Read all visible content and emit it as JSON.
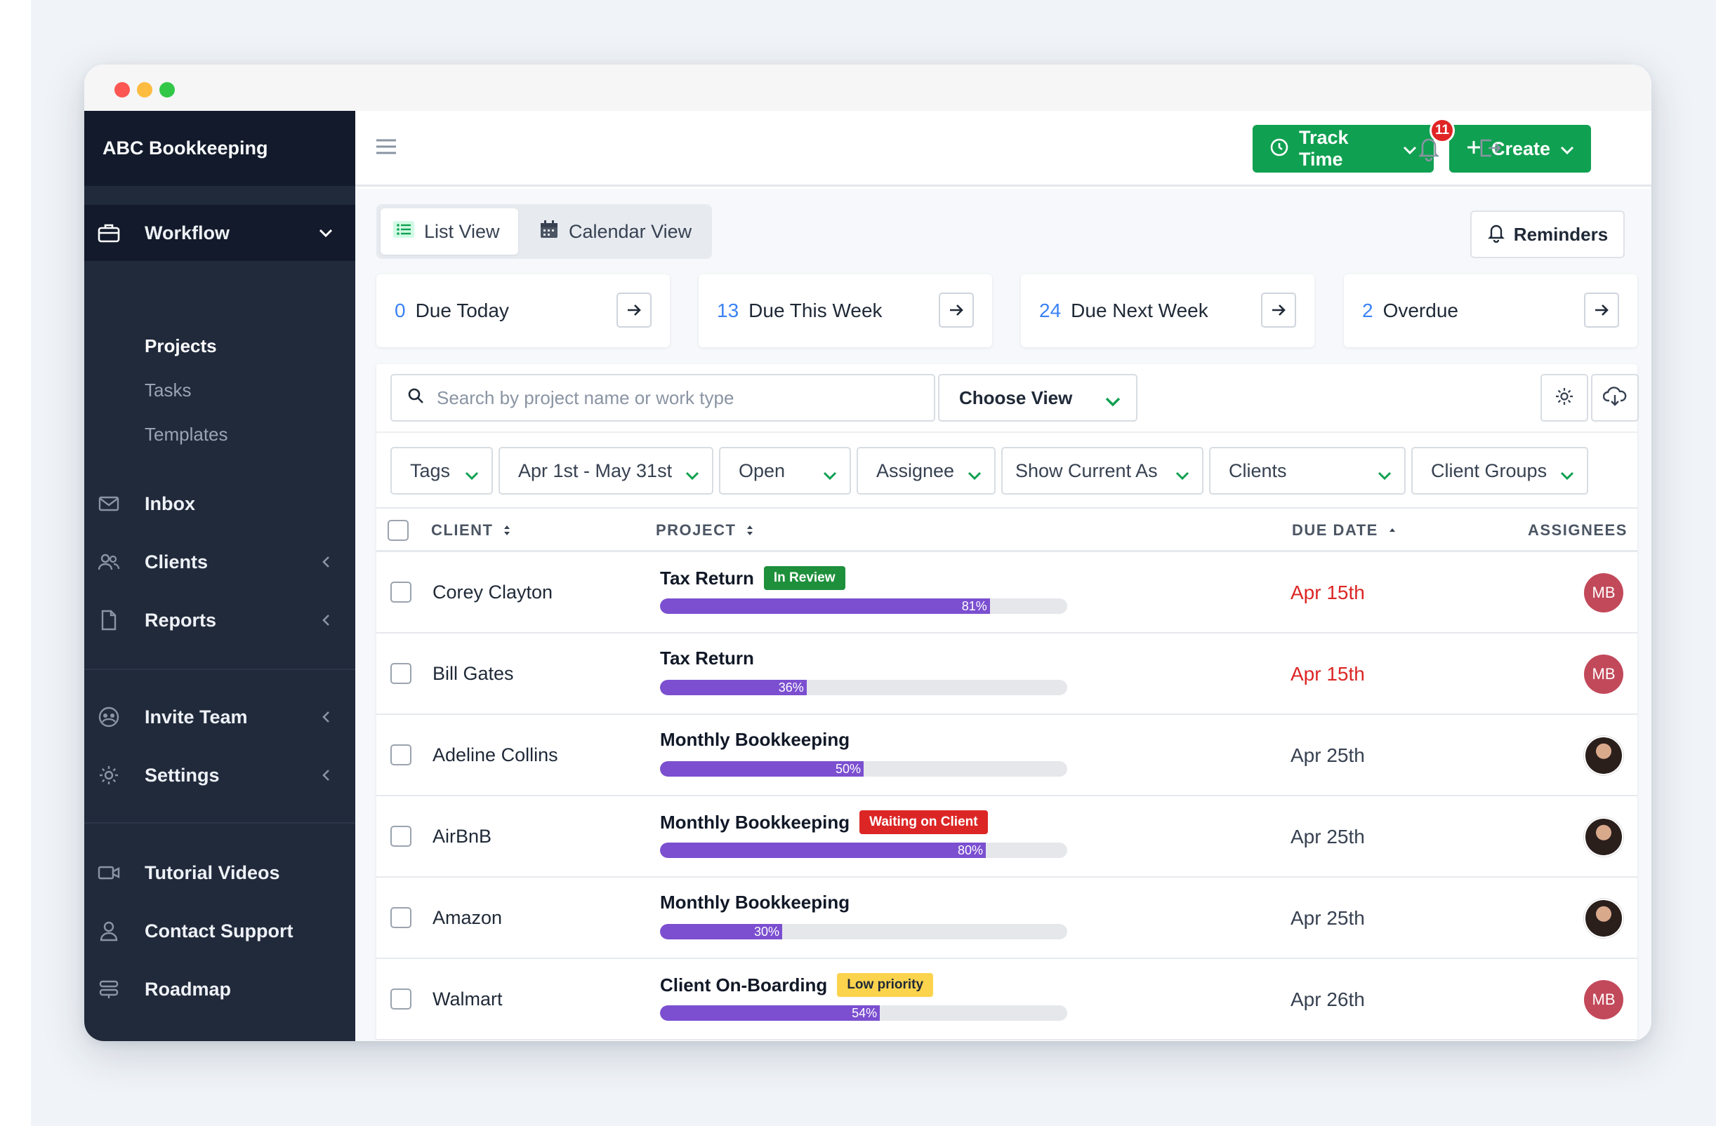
{
  "brand": "ABC Bookkeeping",
  "sidebar": {
    "workflow": "Workflow",
    "sub": [
      "Projects",
      "Tasks",
      "Templates"
    ],
    "items": [
      {
        "label": "Inbox",
        "icon": "envelope-icon"
      },
      {
        "label": "Clients",
        "icon": "users-icon"
      },
      {
        "label": "Reports",
        "icon": "document-icon"
      },
      {
        "label": "Invite Team",
        "icon": "team-icon"
      },
      {
        "label": "Settings",
        "icon": "gear-icon"
      },
      {
        "label": "Tutorial Videos",
        "icon": "video-icon"
      },
      {
        "label": "Contact Support",
        "icon": "person-icon"
      },
      {
        "label": "Roadmap",
        "icon": "roadmap-icon"
      }
    ]
  },
  "topbar": {
    "track_time": "Track Time",
    "create": "Create",
    "notification_count": "11"
  },
  "views": {
    "list": "List View",
    "calendar": "Calendar View",
    "reminders": "Reminders"
  },
  "stats": [
    {
      "num": "0",
      "label": "Due Today"
    },
    {
      "num": "13",
      "label": "Due This Week"
    },
    {
      "num": "24",
      "label": "Due Next Week"
    },
    {
      "num": "2",
      "label": "Overdue"
    }
  ],
  "search": {
    "placeholder": "Search by project name or work type"
  },
  "choose_view": "Choose View",
  "filters": [
    "Tags",
    "Apr 1st - May 31st",
    "Open",
    "Assignee",
    "Show Current As",
    "Clients",
    "Client Groups"
  ],
  "table": {
    "headers": {
      "client": "CLIENT",
      "project": "PROJECT",
      "due": "DUE DATE",
      "assignees": "ASSIGNEES"
    },
    "rows": [
      {
        "client": "Corey Clayton",
        "project": "Tax Return",
        "tag": "In Review",
        "progress": 81,
        "progress_label": "81%",
        "due": "Apr 15th",
        "assignee": "MB"
      },
      {
        "client": "Bill Gates",
        "project": "Tax Return",
        "tag": "",
        "progress": 36,
        "progress_label": "36%",
        "due": "Apr 15th",
        "assignee": "MB"
      },
      {
        "client": "Adeline Collins",
        "project": "Monthly Bookkeeping",
        "tag": "",
        "progress": 50,
        "progress_label": "50%",
        "due": "Apr 25th",
        "assignee": ""
      },
      {
        "client": "AirBnB",
        "project": "Monthly Bookkeeping",
        "tag": "Waiting on Client",
        "progress": 80,
        "progress_label": "80%",
        "due": "Apr 25th",
        "assignee": ""
      },
      {
        "client": "Amazon",
        "project": "Monthly Bookkeeping",
        "tag": "",
        "progress": 30,
        "progress_label": "30%",
        "due": "Apr 25th",
        "assignee": ""
      },
      {
        "client": "Walmart",
        "project": "Client On-Boarding",
        "tag": "Low priority",
        "progress": 54,
        "progress_label": "54%",
        "due": "Apr 26th",
        "assignee": "MB"
      }
    ]
  },
  "colors": {
    "accent_green": "#10a051",
    "progress_purple": "#7b4fd0",
    "overdue_red": "#dc2626",
    "link_blue": "#3b82f6"
  }
}
